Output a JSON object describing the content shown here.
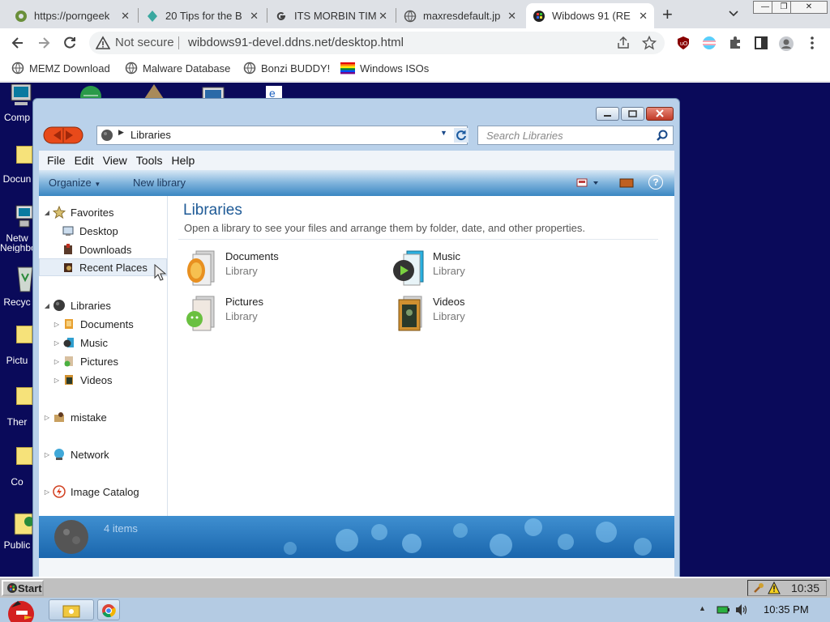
{
  "browser": {
    "tabs": [
      {
        "title": "https://porngeek",
        "active": false
      },
      {
        "title": "20 Tips for the B",
        "active": false
      },
      {
        "title": "ITS MORBIN TIM",
        "active": false
      },
      {
        "title": "maxresdefault.jp",
        "active": false
      },
      {
        "title": "Wibdows 91 (RE",
        "active": true
      }
    ],
    "close_glyph": "✕",
    "new_tab_glyph": "+",
    "security_label": "Not secure",
    "url": "wibdows91-devel.ddns.net/desktop.html",
    "bookmarks": [
      "MEMZ Download",
      "Malware Database",
      "Bonzi BUDDY!",
      "Windows ISOs"
    ],
    "accent": "#1a73e8"
  },
  "desktop": {
    "icons": [
      "Comp",
      "Docun",
      "Netw Neighbor",
      "Recyc",
      "Pictu",
      "Ther",
      "Co",
      "Public"
    ]
  },
  "explorer": {
    "address": "Libraries",
    "search_placeholder": "Search Libraries",
    "menu": [
      "File",
      "Edit",
      "View",
      "Tools",
      "Help"
    ],
    "organize": "Organize",
    "new_library": "New library",
    "help_glyph": "?",
    "nav": {
      "favorites": "Favorites",
      "favorites_items": [
        "Desktop",
        "Downloads",
        "Recent Places"
      ],
      "libraries": "Libraries",
      "libraries_items": [
        "Documents",
        "Music",
        "Pictures",
        "Videos"
      ],
      "mistake": "mistake",
      "network": "Network",
      "image_catalog": "Image Catalog"
    },
    "heading": "Libraries",
    "description": "Open a library to see your files and arrange them by folder, date, and other properties.",
    "items": [
      {
        "name": "Documents",
        "type": "Library"
      },
      {
        "name": "Music",
        "type": "Library"
      },
      {
        "name": "Pictures",
        "type": "Library"
      },
      {
        "name": "Videos",
        "type": "Library"
      }
    ],
    "item_count": "4 items"
  },
  "w91_taskbar": {
    "start": "Start",
    "time": "10:35"
  },
  "win_taskbar": {
    "time": "10:35 PM"
  }
}
